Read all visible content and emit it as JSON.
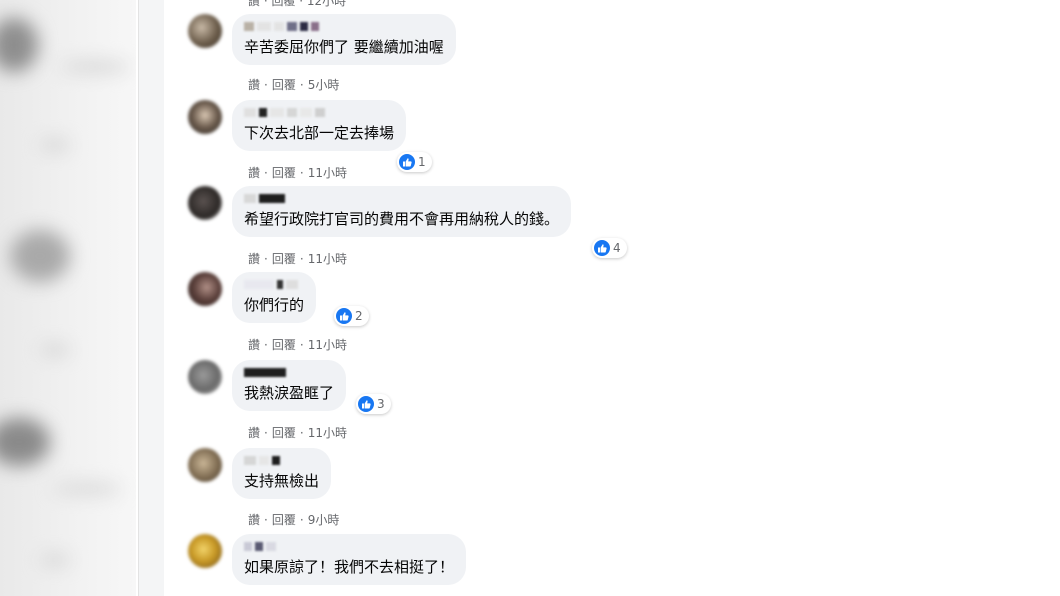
{
  "top_meta": "讚 · 回覆 · 12小時",
  "actions": {
    "like": "讚",
    "reply": "回覆"
  },
  "comments": [
    {
      "text": "辛苦委屈你們了 要繼續加油喔",
      "time": "5小時",
      "reactions": ""
    },
    {
      "text": "下次去北部一定去捧場",
      "time": "11小時",
      "reactions": "1"
    },
    {
      "text": "希望行政院打官司的費用不會再用納稅人的錢。",
      "time": "11小時",
      "reactions": "4"
    },
    {
      "text": "你們行的",
      "time": "11小時",
      "reactions": "2"
    },
    {
      "text": "我熱淚盈眶了",
      "time": "11小時",
      "reactions": "3"
    },
    {
      "text": "支持無檢出",
      "time": "9小時",
      "reactions": ""
    },
    {
      "text": "如果原諒了！我們不去相挺了！",
      "time": "",
      "reactions": ""
    }
  ],
  "colors": {
    "like_blue": "#1877f2",
    "bubble": "#f0f2f5",
    "meta": "#65676b"
  },
  "icons": {
    "reaction": "thumbs-up-icon"
  }
}
